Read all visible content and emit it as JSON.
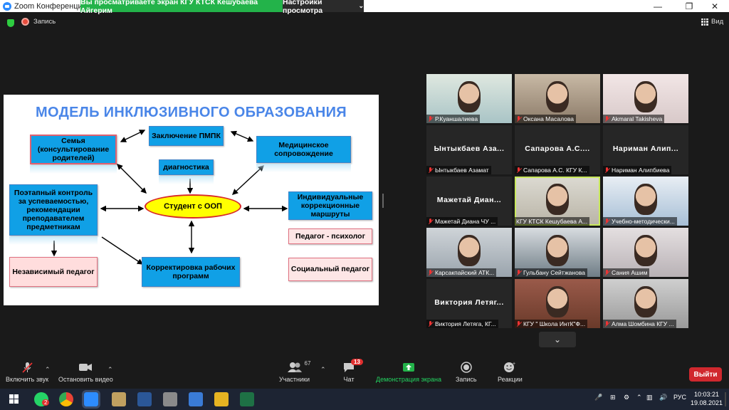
{
  "window": {
    "title": "Zoom Конференция",
    "share_banner": "Вы просматриваете экран КГУ КТСК Кешубаева Айгерим",
    "view_options": "Настройки просмотра",
    "minimize": "—",
    "restore": "❐",
    "close": "✕"
  },
  "meeting": {
    "record_label": "Запись",
    "view_label": "Вид"
  },
  "slide": {
    "title": "МОДЕЛЬ ИНКЛЮЗИВНОГО ОБРАЗОВАНИЯ",
    "center": "Студент с ООП",
    "boxes": {
      "family": "Семья (консультирование родителей)",
      "pmpk": "Заключение ПМПК",
      "medical": "Медицинское сопровождение",
      "diagnostics": "диагностика",
      "control": "Поэтапный контроль за успеваемостью, рекомендации преподавателем предметникам",
      "routes": "Индивидуальные коррекционные маршруты",
      "psychologist": "Педагог - психолог",
      "independent": "Независимый педагог",
      "correction": "Корректировка рабочих программ",
      "social": "Социальный педагог"
    }
  },
  "participants": [
    {
      "label": "Р.Куаншалиева",
      "name_display": "",
      "muted": true
    },
    {
      "label": "Оксана Масалова",
      "name_display": "",
      "muted": true
    },
    {
      "label": "Akmaral Takisheva",
      "name_display": "",
      "muted": true
    },
    {
      "label": "Ынтыкбаев Азамат",
      "name_display": "Ынтыкбаев Аза...",
      "muted": true
    },
    {
      "label": "Сапарова А.С. КГУ К...",
      "name_display": "Сапарова А.С....",
      "muted": true
    },
    {
      "label": "Нариман Алипбиева",
      "name_display": "Нариман Алип...",
      "muted": true
    },
    {
      "label": "Мажетай Диана ЧУ ...",
      "name_display": "Мажетай Диан...",
      "muted": true
    },
    {
      "label": "КГУ КТСК Кешубаева А...",
      "name_display": "",
      "muted": false
    },
    {
      "label": "Учебно-методически...",
      "name_display": "",
      "muted": true
    },
    {
      "label": "Карсакпайский АТК...",
      "name_display": "",
      "muted": true
    },
    {
      "label": "Гульбану Сейтжанова",
      "name_display": "",
      "muted": true
    },
    {
      "label": "Сания Ашим",
      "name_display": "",
      "muted": true
    },
    {
      "label": "Виктория Летяга, КГ...",
      "name_display": "Виктория Летяг...",
      "muted": true
    },
    {
      "label": "КГУ \" Школа ИнтК\"Ф...",
      "name_display": "",
      "muted": true
    },
    {
      "label": "Алма Шомбина КГУ ...",
      "name_display": "",
      "muted": true
    }
  ],
  "scroll_down": "⌄",
  "controls": {
    "audio": "Включить звук",
    "video": "Остановить видео",
    "participants": "Участники",
    "participants_count": "67",
    "chat": "Чат",
    "chat_badge": "13",
    "share": "Демонстрация экрана",
    "record": "Запись",
    "reactions": "Реакции",
    "leave": "Выйти"
  },
  "taskbar": {
    "whatsapp_badge": "2",
    "lang": "РУС",
    "time": "10:03:21",
    "date": "19.08.2021"
  }
}
